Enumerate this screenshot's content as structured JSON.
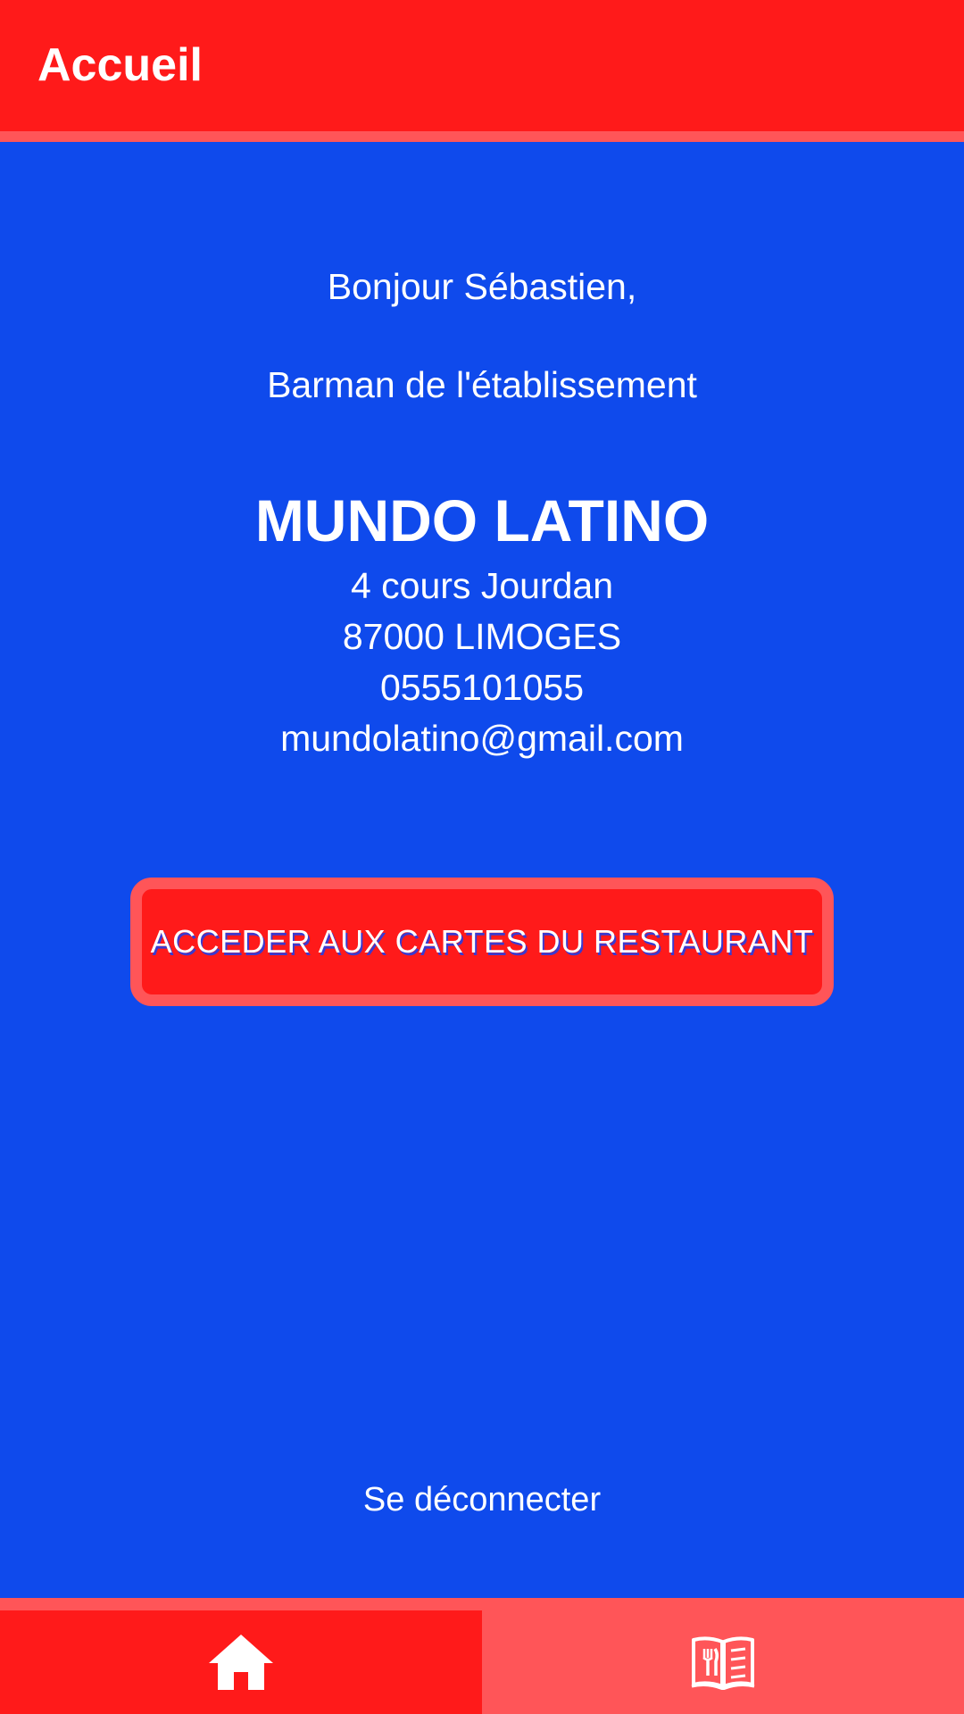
{
  "header": {
    "title": "Accueil"
  },
  "main": {
    "greeting": "Bonjour Sébastien,",
    "role": "Barman de l'établissement",
    "restaurant": {
      "name": "MUNDO LATINO",
      "address": "4 cours Jourdan",
      "city": "87000 LIMOGES",
      "phone": "0555101055",
      "email": "mundolatino@gmail.com"
    },
    "cartes_button_label": "ACCEDER AUX CARTES DU RESTAURANT",
    "logout_label": "Se déconnecter"
  },
  "bottom_nav": {
    "tabs": [
      {
        "icon": "home-icon",
        "active": true
      },
      {
        "icon": "menu-book-icon",
        "active": false
      }
    ]
  },
  "colors": {
    "background": "#0f4aec",
    "primary_red": "#ff1a1a",
    "light_red": "#ff5558",
    "text": "#ffffff"
  }
}
